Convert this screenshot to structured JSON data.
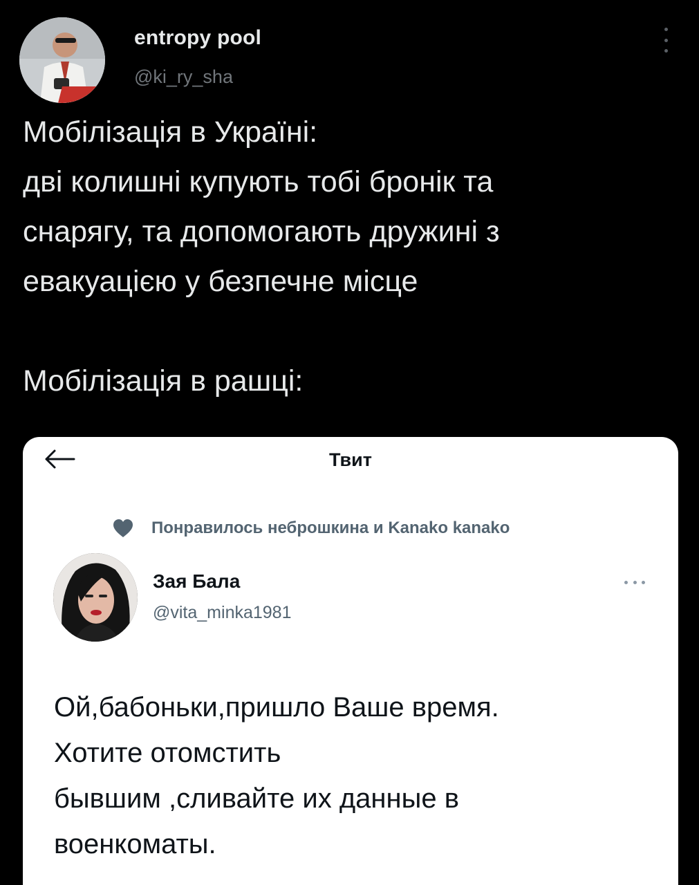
{
  "tweet": {
    "author_name": "entropy pool",
    "author_handle": "@ki_ry_sha",
    "text_lines": [
      "Мобілізація в Україні:",
      "дві колишні купують тобі бронік та",
      "снарягу, та допомогають дружині з",
      "евакуацією у безпечне місце",
      "",
      "Мобілізація в рашці:"
    ]
  },
  "embedded_screenshot": {
    "page_title": "Твит",
    "liked_by": "Понравилось неброшкина и Kanako kanako",
    "author_name": "Зая Бала",
    "author_handle": "@vita_minka1981",
    "text_lines": [
      "Ой,бабоньки,пришло Ваше время.",
      "Хотите отомстить",
      "бывшим ,сливайте их данные в",
      "военкоматы."
    ]
  },
  "colors": {
    "background": "#000000",
    "text_primary_dark": "#e7e9ea",
    "text_secondary_dark": "#71767b",
    "card_background": "#ffffff",
    "text_primary_light": "#0f1419",
    "text_secondary_light": "#536471",
    "heart": "#536471"
  },
  "icons": {
    "more": "more-vertical-icon",
    "back": "arrow-left-icon",
    "liked": "heart-icon",
    "inner_more": "more-horizontal-icon"
  }
}
